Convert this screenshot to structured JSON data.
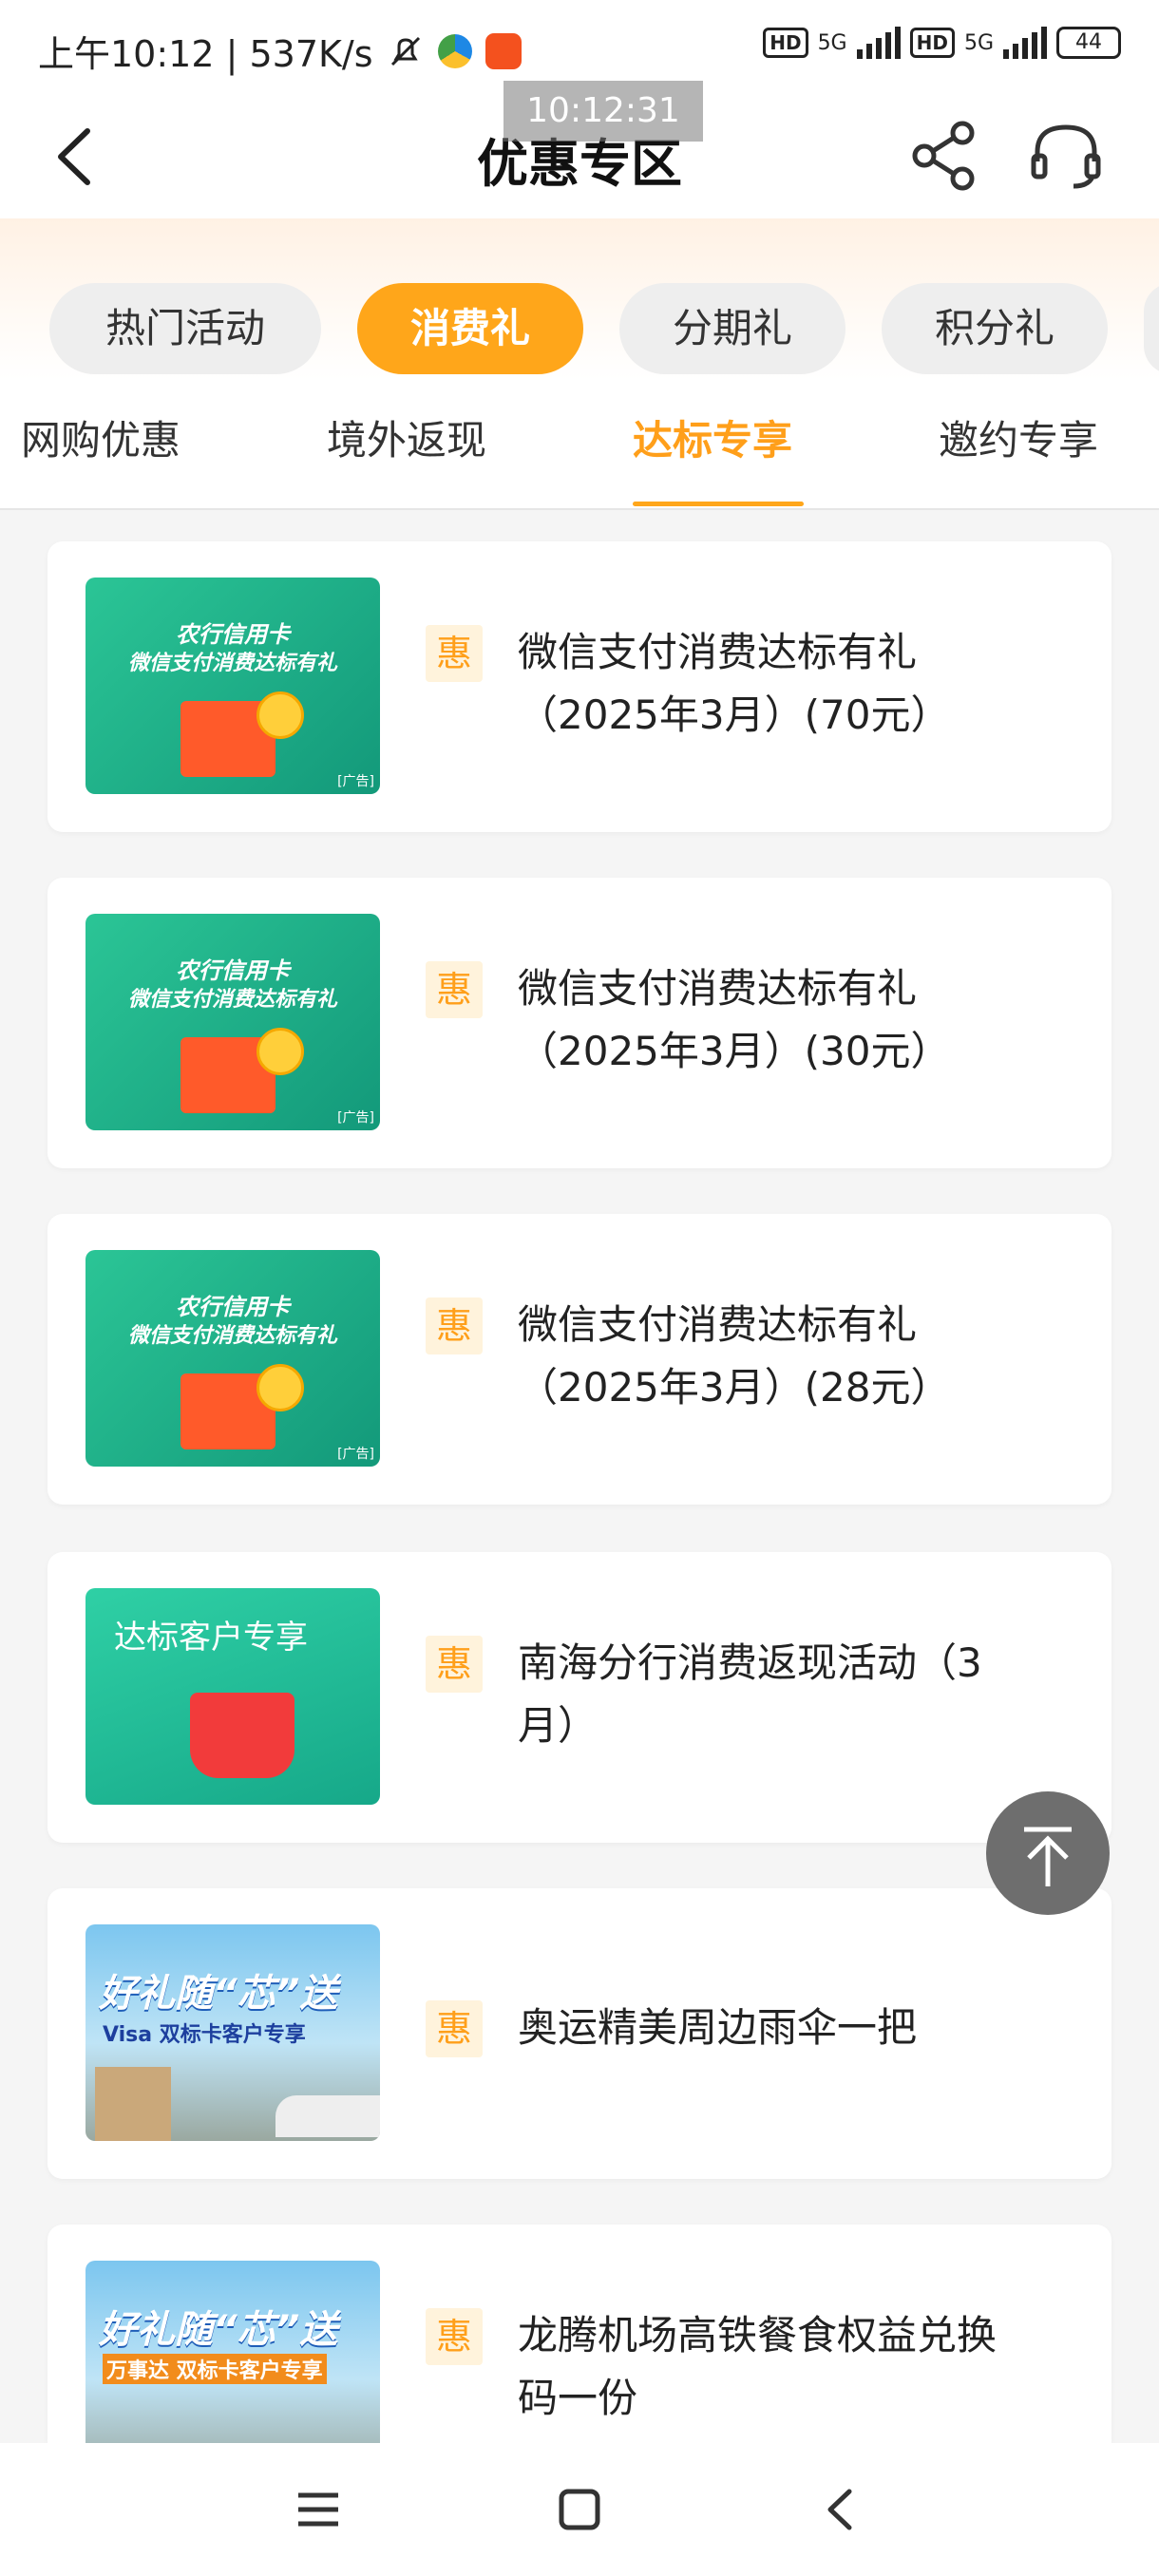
{
  "status_bar": {
    "left_text": "上午10:12 | 537K/s",
    "network_label_1": "5G",
    "network_label_2": "5G",
    "hd_label": "HD",
    "battery": "44",
    "overlay_time": "10:12:31"
  },
  "header": {
    "title": "优惠专区"
  },
  "categories": [
    {
      "label": "热门活动",
      "active": false
    },
    {
      "label": "消费礼",
      "active": true
    },
    {
      "label": "分期礼",
      "active": false
    },
    {
      "label": "积分礼",
      "active": false
    }
  ],
  "subtabs": [
    {
      "label": "网购优惠",
      "active": false
    },
    {
      "label": "境外返现",
      "active": false
    },
    {
      "label": "达标专享",
      "active": true
    },
    {
      "label": "邀约专享",
      "active": false
    }
  ],
  "tag_label": "惠",
  "thumbs": {
    "abc_title": "农行信用卡",
    "abc_subtitle": "微信支付消费达标有礼",
    "ad_label": "[广告]",
    "vip_title": "达标客户专享",
    "visa_title": "好礼随“芯”送",
    "visa_sub": "Visa 双标卡客户专享",
    "wan_sub": "万事达 双标卡客户专享"
  },
  "list": [
    {
      "title_line1": "微信支付消费达标有礼",
      "title_line2": "（2025年3月）(70元）"
    },
    {
      "title_line1": "微信支付消费达标有礼",
      "title_line2": "（2025年3月）(30元）"
    },
    {
      "title_line1": "微信支付消费达标有礼",
      "title_line2": "（2025年3月）(28元）"
    },
    {
      "title_line1": "南海分行消费返现活动（3",
      "title_line2": "月）"
    },
    {
      "title_line1": "奥运精美周边雨伞一把",
      "title_line2": ""
    },
    {
      "title_line1": "龙腾机场高铁餐食权益兑换",
      "title_line2": "码一份"
    }
  ],
  "colors": {
    "accent": "#ffa61a",
    "tag_bg": "#fff3dc",
    "thumb_green": "#22b38a"
  }
}
